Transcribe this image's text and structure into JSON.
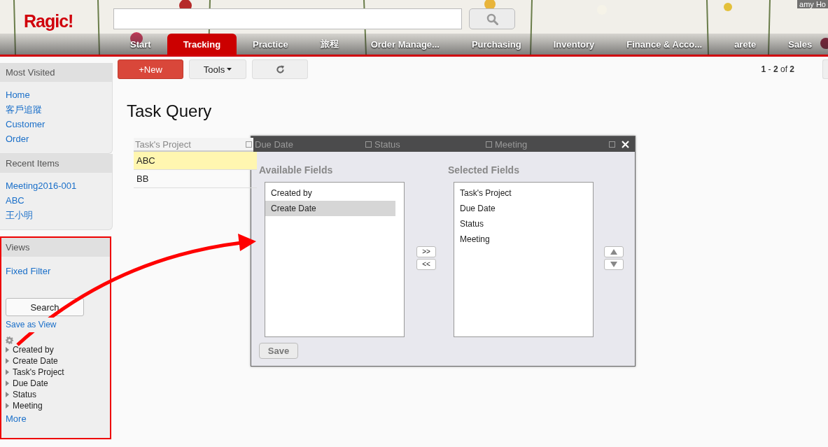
{
  "header": {
    "logo": "Ragic!",
    "user": "amy Ho"
  },
  "tabs": [
    {
      "label": "Start",
      "selected": false
    },
    {
      "label": "Tracking",
      "selected": true
    },
    {
      "label": "Practice",
      "selected": false
    },
    {
      "label": "旅程",
      "selected": false
    },
    {
      "label": "Order Manage...",
      "selected": false
    },
    {
      "label": "Purchasing",
      "selected": false
    },
    {
      "label": "Inventory",
      "selected": false
    },
    {
      "label": "Finance & Acco...",
      "selected": false
    },
    {
      "label": "arete",
      "selected": false
    },
    {
      "label": "Sales",
      "selected": false
    }
  ],
  "sidebar": {
    "most_visited": {
      "title": "Most Visited",
      "items": [
        "Home",
        "客戶追蹤",
        "Customer",
        "Order"
      ]
    },
    "recent": {
      "title": "Recent Items",
      "items": [
        "Meeting2016-001",
        "ABC",
        "王小明"
      ]
    },
    "views": {
      "title": "Views",
      "items": [
        "Fixed Filter"
      ],
      "search_button": "Search",
      "save_link": "Save as View",
      "filters": [
        {
          "label": "Created by",
          "expanded": false
        },
        {
          "label": "Create Date",
          "expanded": false
        },
        {
          "label": "Task's Project",
          "expanded": false
        },
        {
          "label": "Due Date",
          "expanded": false
        },
        {
          "label": "Status",
          "expanded": false
        },
        {
          "label": "Meeting",
          "expanded": false
        }
      ],
      "more": "More"
    }
  },
  "toolbar": {
    "new_button": "+New",
    "tools_button": "Tools",
    "pagination": "**1** - **2** of **2**"
  },
  "page_title": "Task Query",
  "table": {
    "columns": [
      "Task's Project",
      "Due Date",
      "Status",
      "Meeting"
    ],
    "rows": [
      {
        "cells": [
          "ABC"
        ],
        "selected": true
      },
      {
        "cells": [
          "BB"
        ],
        "selected": false
      }
    ]
  },
  "dialog": {
    "available_title": "Available Fields",
    "selected_title": "Selected Fields",
    "available": [
      {
        "label": "Created by",
        "selected": false
      },
      {
        "label": "Create Date",
        "selected": true
      }
    ],
    "chosen": [
      {
        "label": "Task's Project",
        "selected": false
      },
      {
        "label": "Due Date",
        "selected": false
      },
      {
        "label": "Status",
        "selected": false
      },
      {
        "label": "Meeting",
        "selected": false
      }
    ],
    "add_button": ">>",
    "remove_button": "<<",
    "save_button": "Save"
  }
}
